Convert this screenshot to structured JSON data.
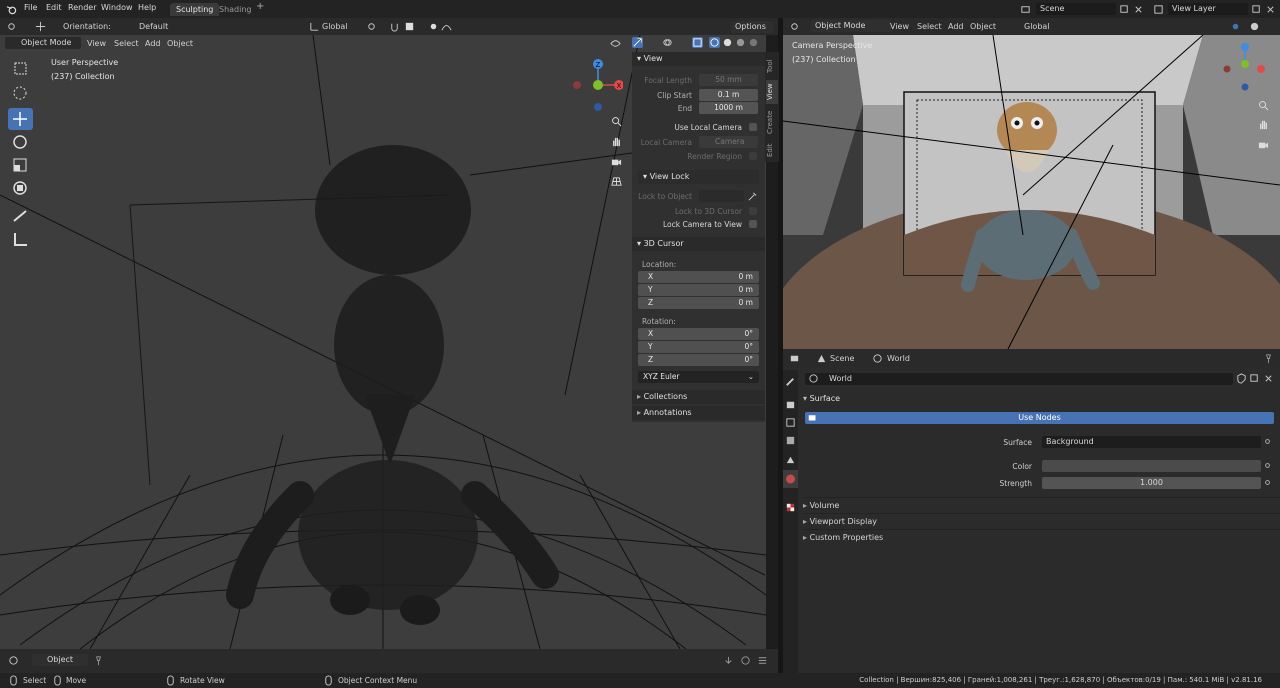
{
  "topbar": {
    "menus": [
      "File",
      "Edit",
      "Render",
      "Window",
      "Help"
    ],
    "workspaces": [
      {
        "label": "Sculpting",
        "active": true
      },
      {
        "label": "Shading",
        "active": false
      }
    ],
    "add_tab": "+",
    "scene": "Scene",
    "view_layer": "View Layer"
  },
  "left_header": {
    "orientation_label": "Orientation:",
    "orientation_value": "Default",
    "transform_space": "Global",
    "options": "Options",
    "mode": "Object Mode",
    "menus": [
      "View",
      "Select",
      "Add",
      "Object"
    ]
  },
  "left_viewport": {
    "perspective": "User Perspective",
    "collection": "(237) Collection"
  },
  "npanel": {
    "view_header": "View",
    "focal_length_label": "Focal Length",
    "focal_length_value": "50 mm",
    "clip_start_label": "Clip Start",
    "clip_start_value": "0.1 m",
    "end_label": "End",
    "end_value": "1000 m",
    "use_local_camera": "Use Local Camera",
    "local_camera_label": "Local Camera",
    "local_camera_value": "Camera",
    "render_region": "Render Region",
    "view_lock_header": "View Lock",
    "lock_to_object": "Lock to Object",
    "lock_to_3d_cursor": "Lock to 3D Cursor",
    "lock_camera_to_view": "Lock Camera to View",
    "cursor_header": "3D Cursor",
    "location_label": "Location:",
    "rotation_label": "Rotation:",
    "loc": [
      {
        "axis": "X",
        "value": "0 m"
      },
      {
        "axis": "Y",
        "value": "0 m"
      },
      {
        "axis": "Z",
        "value": "0 m"
      }
    ],
    "rot": [
      {
        "axis": "X",
        "value": "0°"
      },
      {
        "axis": "Y",
        "value": "0°"
      },
      {
        "axis": "Z",
        "value": "0°"
      }
    ],
    "rotation_mode": "XYZ Euler",
    "collections": "Collections",
    "annotations": "Annotations",
    "tabs": [
      "Tool",
      "View",
      "Create",
      "Edit"
    ]
  },
  "right_header": {
    "mode": "Object Mode",
    "menus": [
      "View",
      "Select",
      "Add",
      "Object"
    ],
    "transform_space": "Global"
  },
  "right_viewport": {
    "perspective": "Camera Perspective",
    "collection": "(237) Collection"
  },
  "properties": {
    "breadcrumb_scene": "Scene",
    "breadcrumb_world": "World",
    "world_name": "World",
    "surface_header": "Surface",
    "use_nodes": "Use Nodes",
    "surface_label": "Surface",
    "surface_value": "Background",
    "color_label": "Color",
    "strength_label": "Strength",
    "strength_value": "1.000",
    "volume": "Volume",
    "viewport_display": "Viewport Display",
    "custom_properties": "Custom Properties"
  },
  "bottom_toolbar": {
    "mode": "Object"
  },
  "statusbar": {
    "select": "Select",
    "move": "Move",
    "rotate_view": "Rotate View",
    "context_menu": "Object Context Menu",
    "stats": "Collection | Вершин:825,406 | Граней:1,008,261 | Треуг.:1,628,870 | Объектов:0/19 | Пам.: 540.1 MiB | v2.81.16"
  },
  "colors": {
    "accent": "#4772b3",
    "axis_x": "#e04a4a",
    "axis_y": "#7fbf2a",
    "axis_z": "#3e8ee0"
  }
}
